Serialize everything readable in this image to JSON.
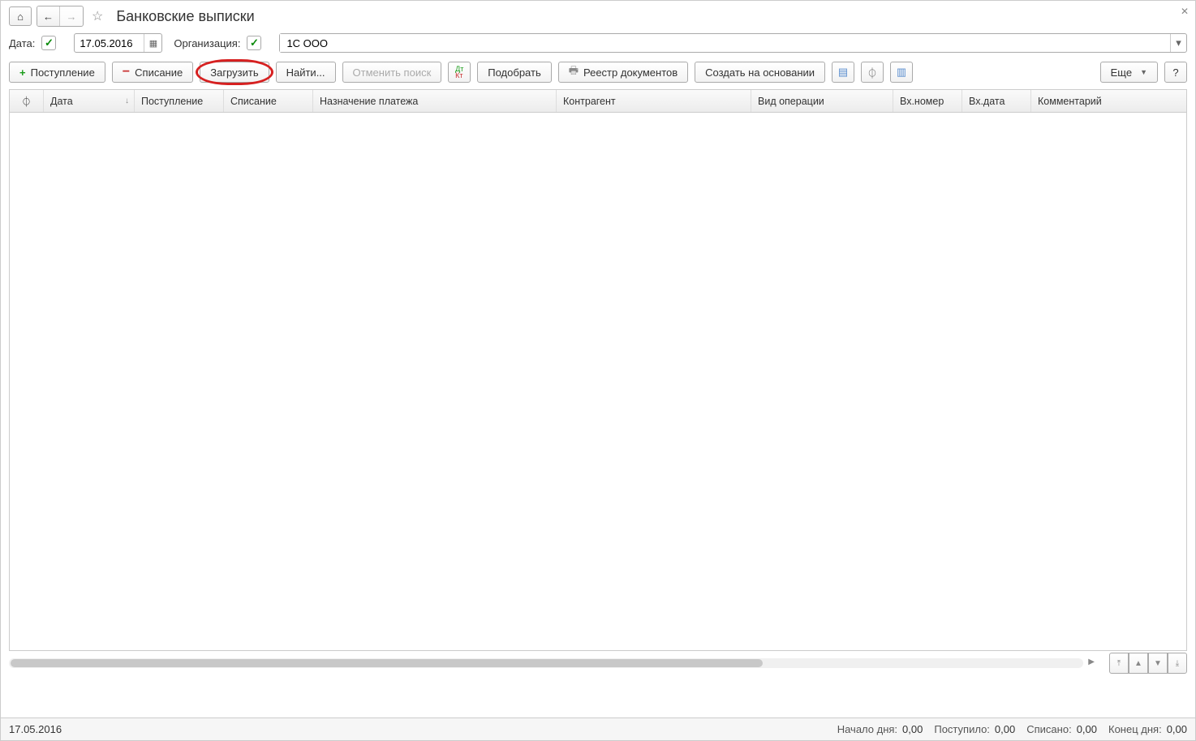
{
  "header": {
    "title": "Банковские выписки"
  },
  "filters": {
    "date_label": "Дата:",
    "date_value": "17.05.2016",
    "org_label": "Организация:",
    "org_value": "1С ООО"
  },
  "toolbar": {
    "inflow": "Поступление",
    "outflow": "Списание",
    "load": "Загрузить",
    "find": "Найти...",
    "cancel_search": "Отменить поиск",
    "pick": "Подобрать",
    "registry": "Реестр документов",
    "create_based": "Создать на основании",
    "more": "Еще",
    "help": "?"
  },
  "columns": {
    "attach": "⏀",
    "date": "Дата",
    "inflow": "Поступление",
    "outflow": "Списание",
    "purpose": "Назначение платежа",
    "counterparty": "Контрагент",
    "op_type": "Вид операции",
    "in_number": "Вх.номер",
    "in_date": "Вх.дата",
    "comment": "Комментарий"
  },
  "status": {
    "date": "17.05.2016",
    "begin_label": "Начало дня:",
    "begin_value": "0,00",
    "in_label": "Поступило:",
    "in_value": "0,00",
    "out_label": "Списано:",
    "out_value": "0,00",
    "end_label": "Конец дня:",
    "end_value": "0,00"
  }
}
